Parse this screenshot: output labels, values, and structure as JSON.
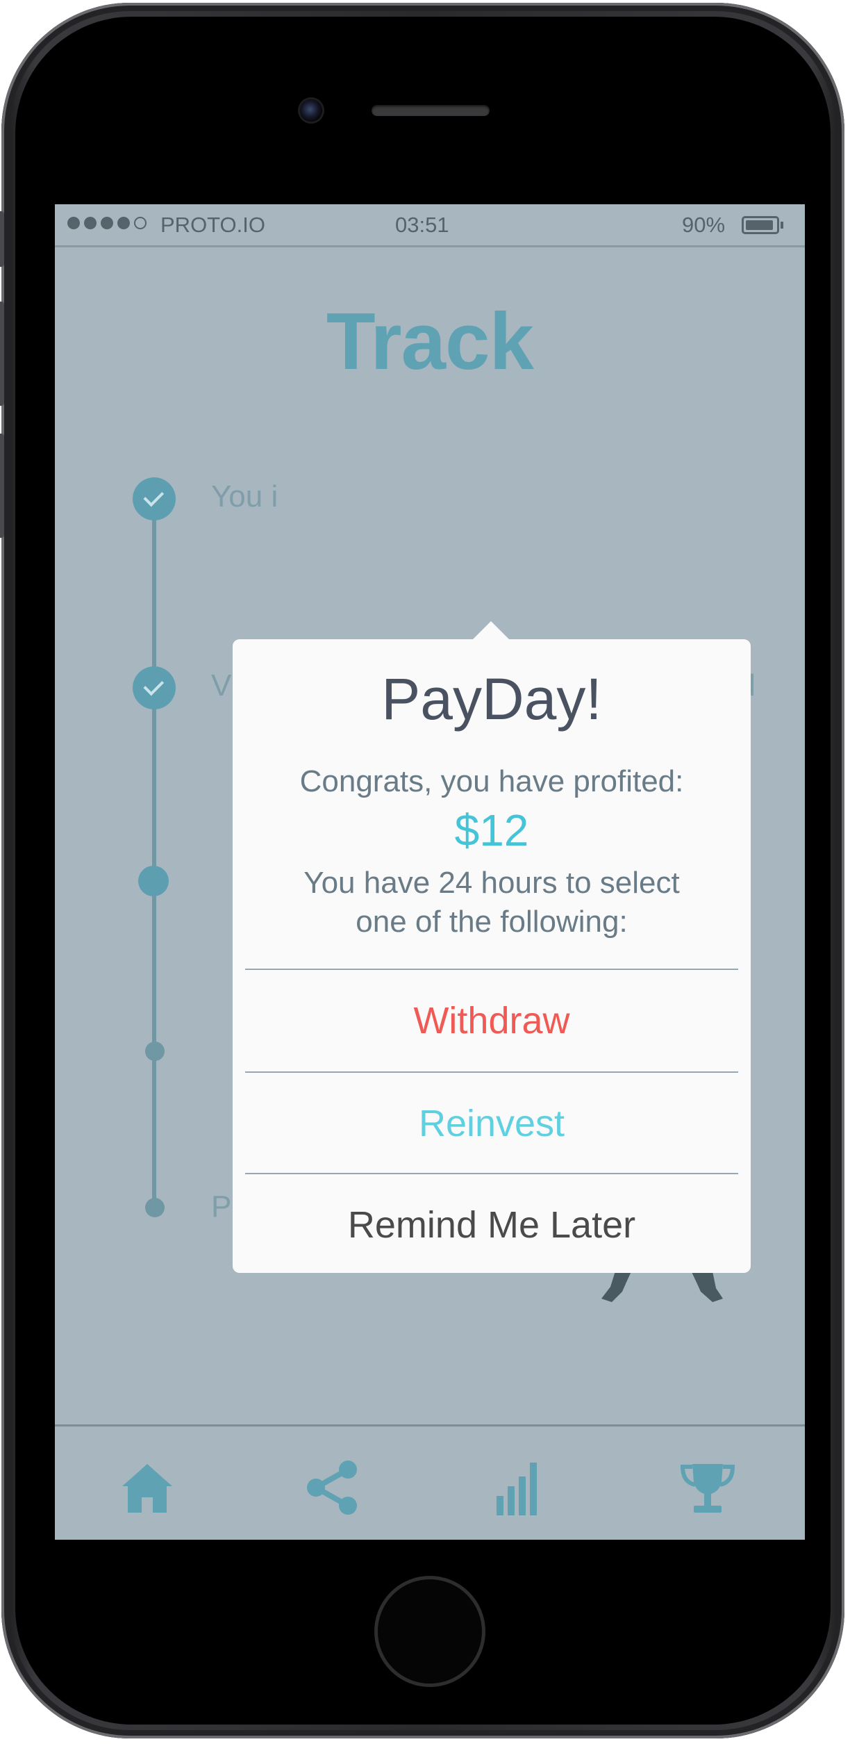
{
  "status_bar": {
    "carrier": "PROTO.IO",
    "time": "03:51",
    "battery": "90%",
    "signal_dots": [
      true,
      true,
      true,
      true,
      false
    ]
  },
  "page": {
    "title": "Track",
    "timeline": {
      "items": [
        "You i",
        "V",
        "Payday!"
      ],
      "partial_suffix": "ed"
    }
  },
  "modal": {
    "title": "PayDay!",
    "message": "Congrats, you have profited:",
    "amount": "$12",
    "instruction_line1": "You have 24 hours to select",
    "instruction_line2": "one of the following:",
    "actions": {
      "withdraw": "Withdraw",
      "reinvest": "Reinvest",
      "remind": "Remind Me Later"
    },
    "colors": {
      "withdraw": "#f05a55",
      "reinvest": "#5fd0e0",
      "remind": "#4a4a4a",
      "amount": "#45c4d8"
    }
  },
  "tab_bar": {
    "tabs": [
      "home-icon",
      "share-icon",
      "bar-chart-icon",
      "trophy-icon"
    ]
  },
  "colors": {
    "screen_bg": "#a8b7bf",
    "accent": "#5fa2b3"
  }
}
